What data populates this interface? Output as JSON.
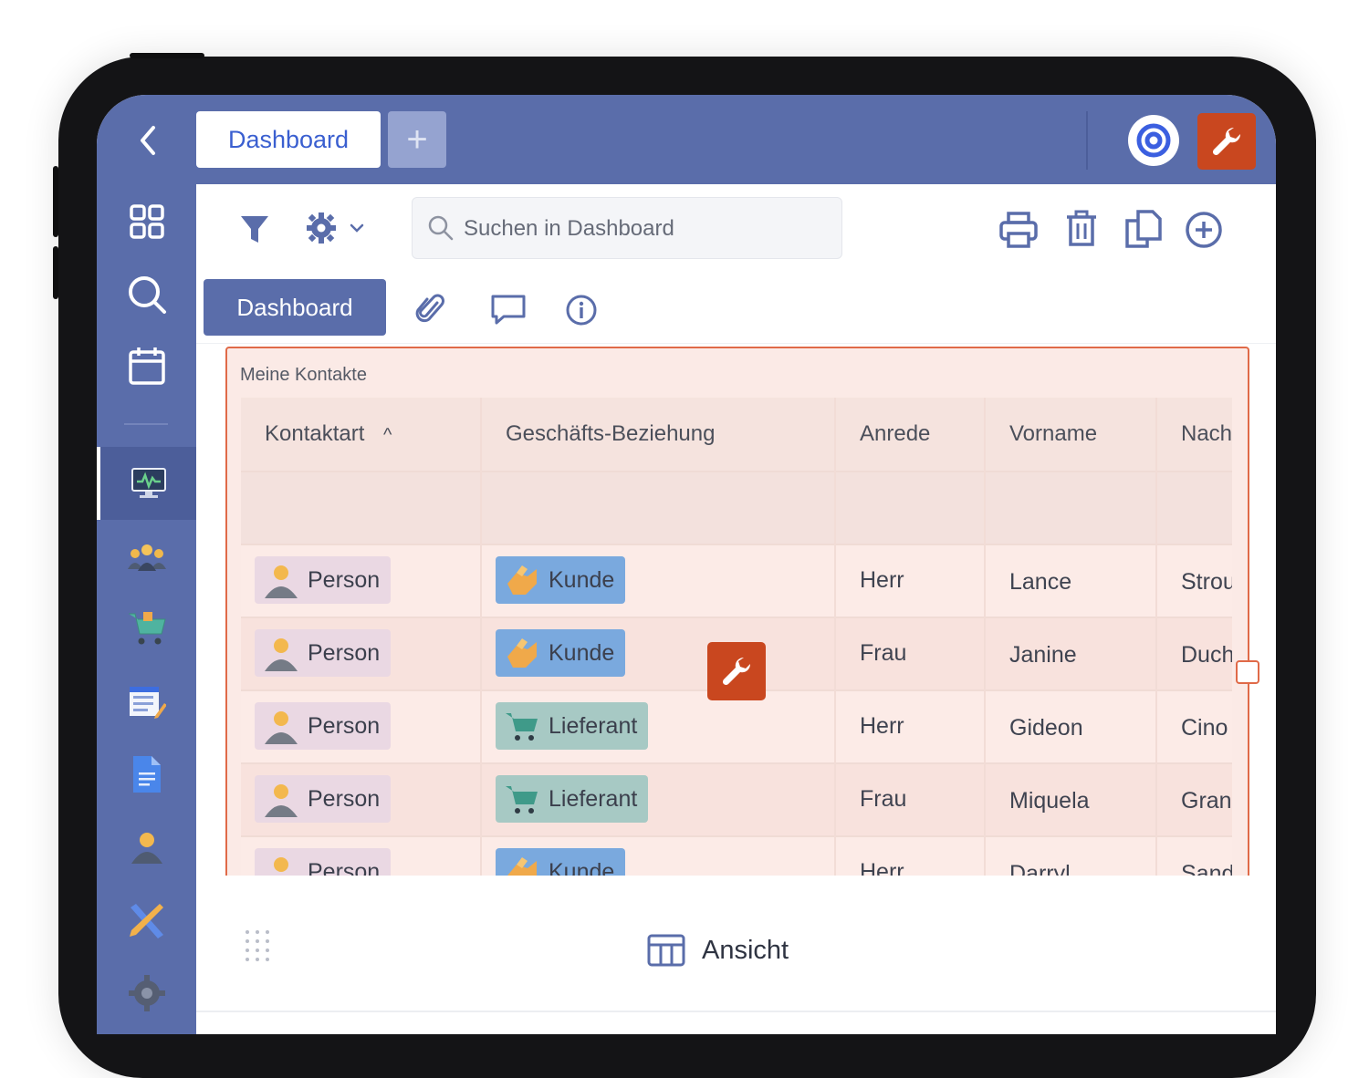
{
  "header": {
    "tab_label": "Dashboard",
    "add_tab_symbol": "+"
  },
  "toolbar": {
    "search_placeholder": "Suchen in Dashboard"
  },
  "subtabs": {
    "active_label": "Dashboard"
  },
  "widget": {
    "title": "Meine Kontakte",
    "columns": [
      "Kontaktart",
      "Geschäfts-Beziehung",
      "Anrede",
      "Vorname",
      "Nach"
    ],
    "sort_indicator": "^",
    "rows": [
      {
        "kontaktart": "Person",
        "beziehung": "Kunde",
        "anrede": "Herr",
        "vorname": "Lance",
        "nachname": "Strou"
      },
      {
        "kontaktart": "Person",
        "beziehung": "Kunde",
        "anrede": "Frau",
        "vorname": "Janine",
        "nachname": "Duch"
      },
      {
        "kontaktart": "Person",
        "beziehung": "Lieferant",
        "anrede": "Herr",
        "vorname": "Gideon",
        "nachname": "Cino"
      },
      {
        "kontaktart": "Person",
        "beziehung": "Lieferant",
        "anrede": "Frau",
        "vorname": "Miquela",
        "nachname": "Gran"
      },
      {
        "kontaktart": "Person",
        "beziehung": "Kunde",
        "anrede": "Herr",
        "vorname": "Darryl",
        "nachname": "Sand"
      }
    ]
  },
  "bottom": {
    "view_label": "Ansicht"
  },
  "colors": {
    "brand": "#5a6daa",
    "accent": "#c9471f",
    "kunde": "#7aa9de",
    "lieferant": "#a7c9c4",
    "person": "#ead8e3"
  }
}
